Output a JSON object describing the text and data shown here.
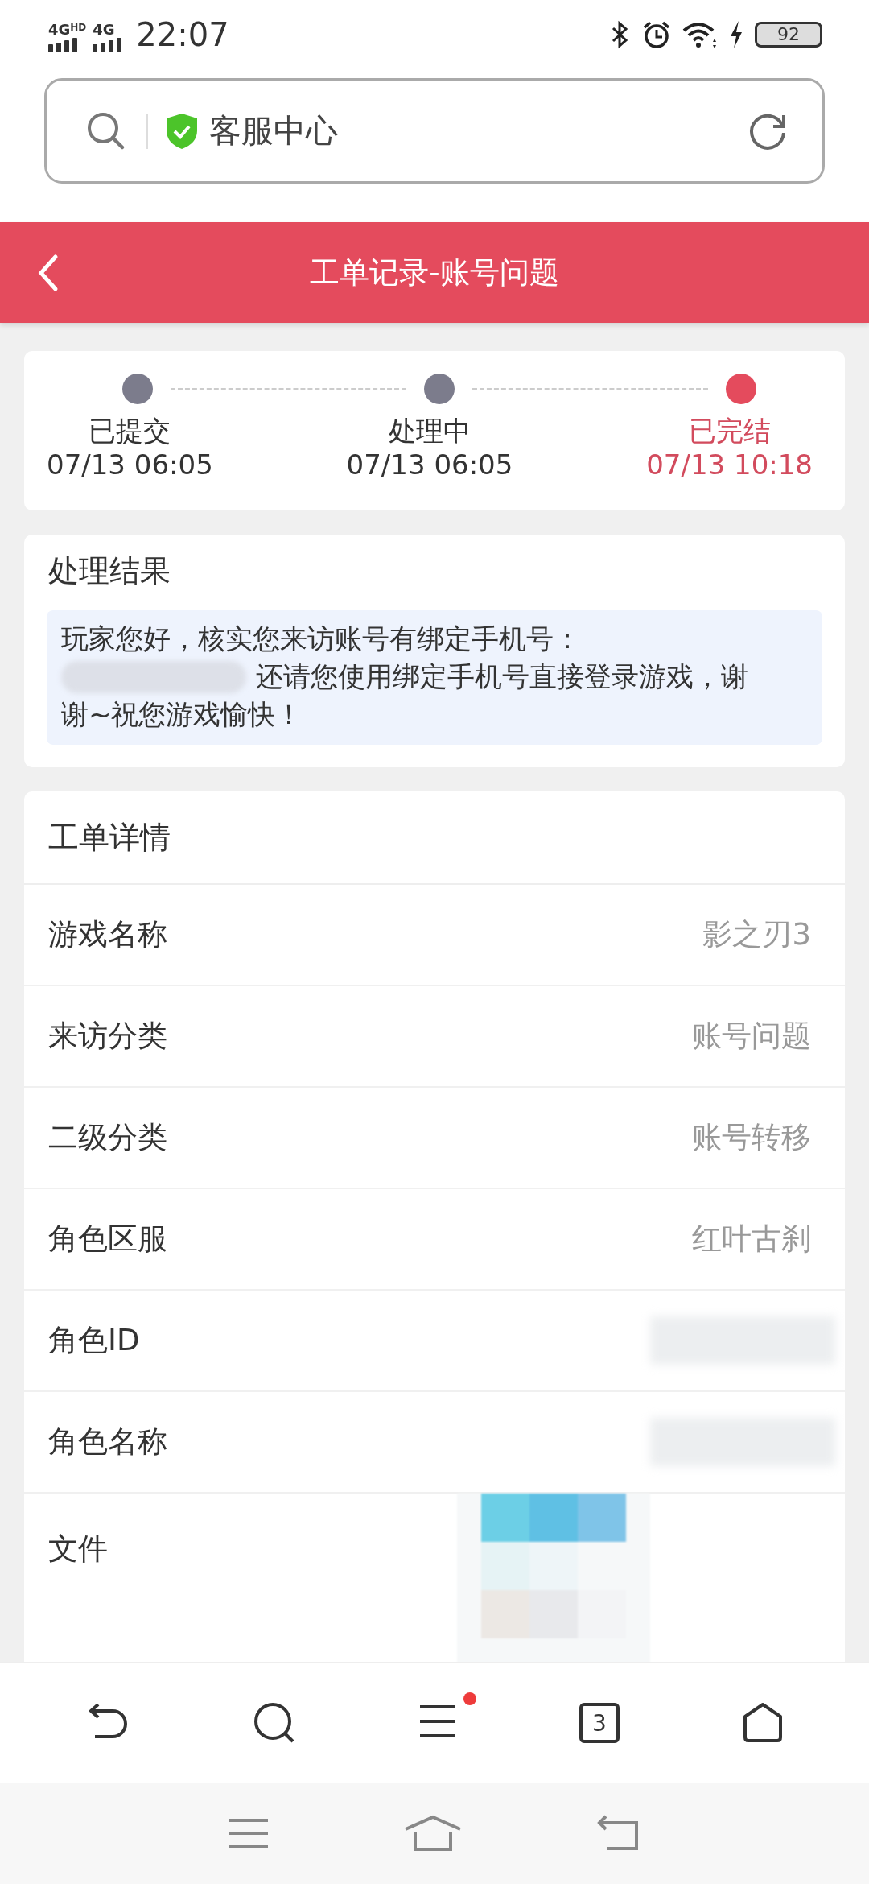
{
  "status_bar": {
    "network_1": "4G",
    "network_1_badge": "HD",
    "network_2": "4G",
    "time": "22:07",
    "battery": "92"
  },
  "address_bar": {
    "secure": true,
    "title": "客服中心"
  },
  "header": {
    "title": "工单记录-账号问题"
  },
  "progress": [
    {
      "label": "已提交",
      "time": "07/13 06:05",
      "current": false
    },
    {
      "label": "处理中",
      "time": "07/13 06:05",
      "current": false
    },
    {
      "label": "已完结",
      "time": "07/13 10:18",
      "current": true
    }
  ],
  "result": {
    "title": "处理结果",
    "message_lines": [
      {
        "text": "玩家您好，核实您来访账号有绑定手机号：",
        "redacted_prefix": false
      },
      {
        "text": "还请您使用绑定手机号直接登录游戏，谢",
        "redacted_prefix": true
      },
      {
        "text": "谢~祝您游戏愉快！",
        "redacted_prefix": false
      }
    ]
  },
  "details": {
    "title": "工单详情",
    "rows": [
      {
        "label": "游戏名称",
        "kind": "text",
        "value": "影之刃3"
      },
      {
        "label": "来访分类",
        "kind": "text",
        "value": "账号问题"
      },
      {
        "label": "二级分类",
        "kind": "text",
        "value": "账号转移"
      },
      {
        "label": "角色区服",
        "kind": "text",
        "value": "红叶古刹"
      },
      {
        "label": "角色ID",
        "kind": "redacted"
      },
      {
        "label": "角色名称",
        "kind": "redacted"
      },
      {
        "label": "文件",
        "kind": "file"
      }
    ]
  },
  "browser_bar": {
    "tab_count": "3",
    "menu_notification": true
  }
}
